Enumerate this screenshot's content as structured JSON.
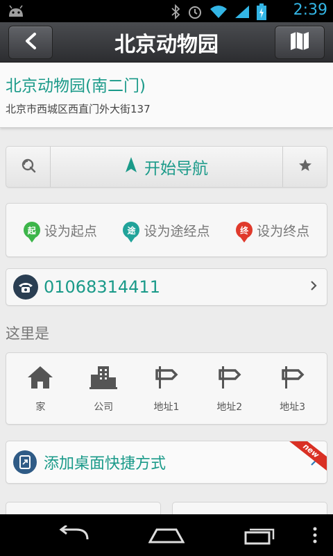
{
  "status_bar": {
    "time": "2:39"
  },
  "title_bar": {
    "title": "北京动物园"
  },
  "place": {
    "name": "北京动物园(南二门)",
    "address": "北京市西城区西直门外大街137"
  },
  "nav": {
    "label": "开始导航"
  },
  "route": {
    "start": {
      "pin": "起",
      "label": "设为起点"
    },
    "via": {
      "pin": "途",
      "label": "设为途经点"
    },
    "end": {
      "pin": "终",
      "label": "设为终点"
    }
  },
  "phone": {
    "number": "01068314411"
  },
  "here_section": {
    "title": "这里是",
    "items": [
      {
        "label": "家",
        "icon": "home-icon"
      },
      {
        "label": "公司",
        "icon": "company-icon"
      },
      {
        "label": "地址1",
        "icon": "signpost-icon"
      },
      {
        "label": "地址2",
        "icon": "signpost-icon"
      },
      {
        "label": "地址3",
        "icon": "signpost-icon"
      }
    ]
  },
  "shortcut": {
    "label": "添加桌面快捷方式",
    "badge": "new"
  },
  "colors": {
    "accent": "#1a9a89",
    "start": "#3db54a",
    "via": "#21a39a",
    "end": "#e03a2c",
    "status": "#33b5e5"
  }
}
